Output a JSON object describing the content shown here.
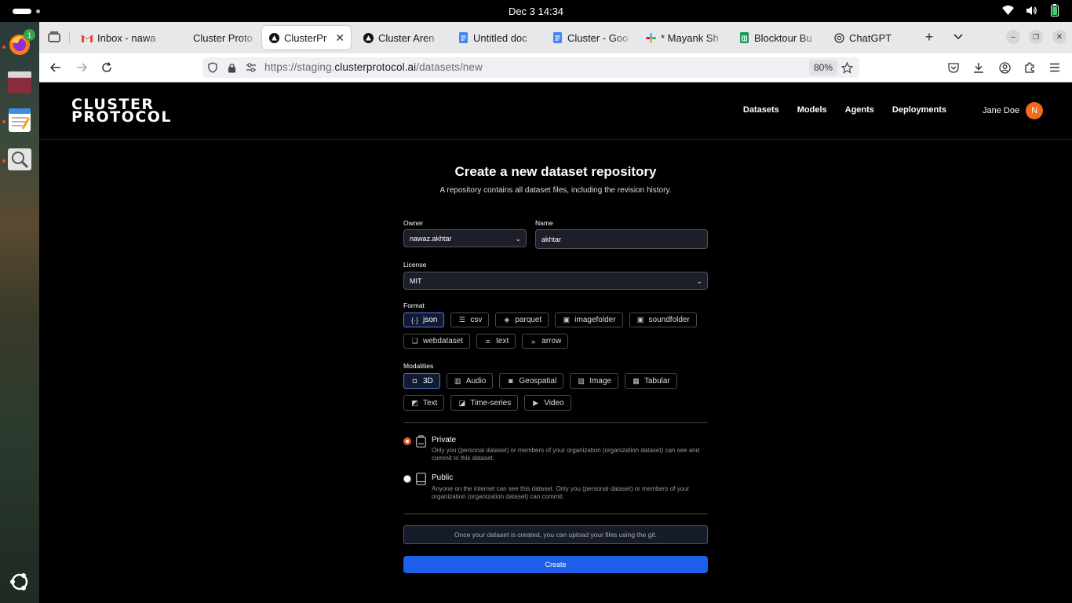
{
  "system": {
    "clock": "Dec 3  14:34",
    "dock_badge": "1"
  },
  "browser": {
    "tabs": [
      {
        "label": "Inbox - nawa",
        "icon": "gmail-icon"
      },
      {
        "label": "Cluster Proto",
        "icon": "cluster-icon"
      },
      {
        "label": "ClusterPro",
        "icon": "cluster-triangle-icon",
        "active": true
      },
      {
        "label": "Cluster Aren",
        "icon": "cluster-triangle-icon"
      },
      {
        "label": "Untitled doc",
        "icon": "docs-icon"
      },
      {
        "label": "Cluster - Goo",
        "icon": "docs-icon"
      },
      {
        "label": "* Mayank Sh",
        "icon": "slack-icon"
      },
      {
        "label": "Blocktour Bu",
        "icon": "sheets-icon"
      },
      {
        "label": "ChatGPT",
        "icon": "chatgpt-icon"
      }
    ],
    "url_prefix": "https://staging.",
    "url_domain": "clusterprotocol.ai",
    "url_path": "/datasets/new",
    "zoom": "80%"
  },
  "site": {
    "logo_line1": "CLUSTER",
    "logo_line2": "PROTOCOL",
    "nav": [
      "Datasets",
      "Models",
      "Agents",
      "Deployments"
    ],
    "user_name": "Jane Doe",
    "avatar_initial": "N"
  },
  "form": {
    "title": "Create a new dataset repository",
    "subtitle": "A repository contains all dataset files, including the revision history.",
    "owner_label": "Owner",
    "owner_value": "nawaz.akhtar",
    "name_label": "Name",
    "name_value": "akhtar",
    "license_label": "License",
    "license_value": "MIT",
    "format_label": "Format",
    "formats": [
      {
        "label": "json",
        "icon": "braces-icon",
        "selected": true
      },
      {
        "label": "csv",
        "icon": "list-icon"
      },
      {
        "label": "parquet",
        "icon": "parquet-icon"
      },
      {
        "label": "imagefolder",
        "icon": "folder-image-icon"
      },
      {
        "label": "soundfolder",
        "icon": "folder-sound-icon"
      },
      {
        "label": "webdataset",
        "icon": "stack-icon"
      },
      {
        "label": "text",
        "icon": "text-lines-icon"
      },
      {
        "label": "arrow",
        "icon": "chevrons-right-icon"
      }
    ],
    "modalities_label": "Modalities",
    "modalities": [
      {
        "label": "3D",
        "icon": "cube-icon",
        "selected": true
      },
      {
        "label": "Audio",
        "icon": "audio-icon"
      },
      {
        "label": "Geospatial",
        "icon": "geo-icon"
      },
      {
        "label": "Image",
        "icon": "image-icon"
      },
      {
        "label": "Tabular",
        "icon": "table-icon"
      },
      {
        "label": "Text",
        "icon": "text-icon"
      },
      {
        "label": "Time-series",
        "icon": "timeseries-icon"
      },
      {
        "label": "Video",
        "icon": "video-icon"
      }
    ],
    "private_title": "Private",
    "private_desc": "Only you (personal dataset) or members of your organization (organization dataset) can see and commit to this dataset.",
    "public_title": "Public",
    "public_desc": "Anyone on the internet can see this dataset. Only you (personal dataset) or members of your organization (organization dataset) can commit.",
    "visibility_selected": "Private",
    "note": "Once your dataset is created, you can upload your files using the git.",
    "create_label": "Create"
  }
}
